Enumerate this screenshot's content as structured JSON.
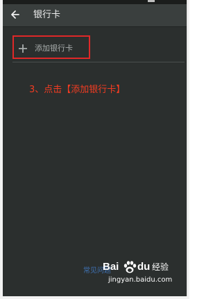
{
  "header": {
    "title": "银行卡",
    "back_icon": "arrow-left-icon"
  },
  "add_card": {
    "icon": "plus-icon",
    "label": "添加银行卡"
  },
  "annotation": {
    "text": "3、点击【添加银行卡】",
    "color": "#f23c22"
  },
  "footer": {
    "link": "常见问题"
  },
  "watermark": {
    "brand_prefix": "Bai",
    "brand_suffix": "du",
    "brand_word": "经验",
    "domain": "jingyan.baidu.com"
  },
  "colors": {
    "screen_bg": "#2b2f2e",
    "header_bg": "#3a3f3e",
    "highlight": "#e02828",
    "link": "#3f72b4"
  }
}
